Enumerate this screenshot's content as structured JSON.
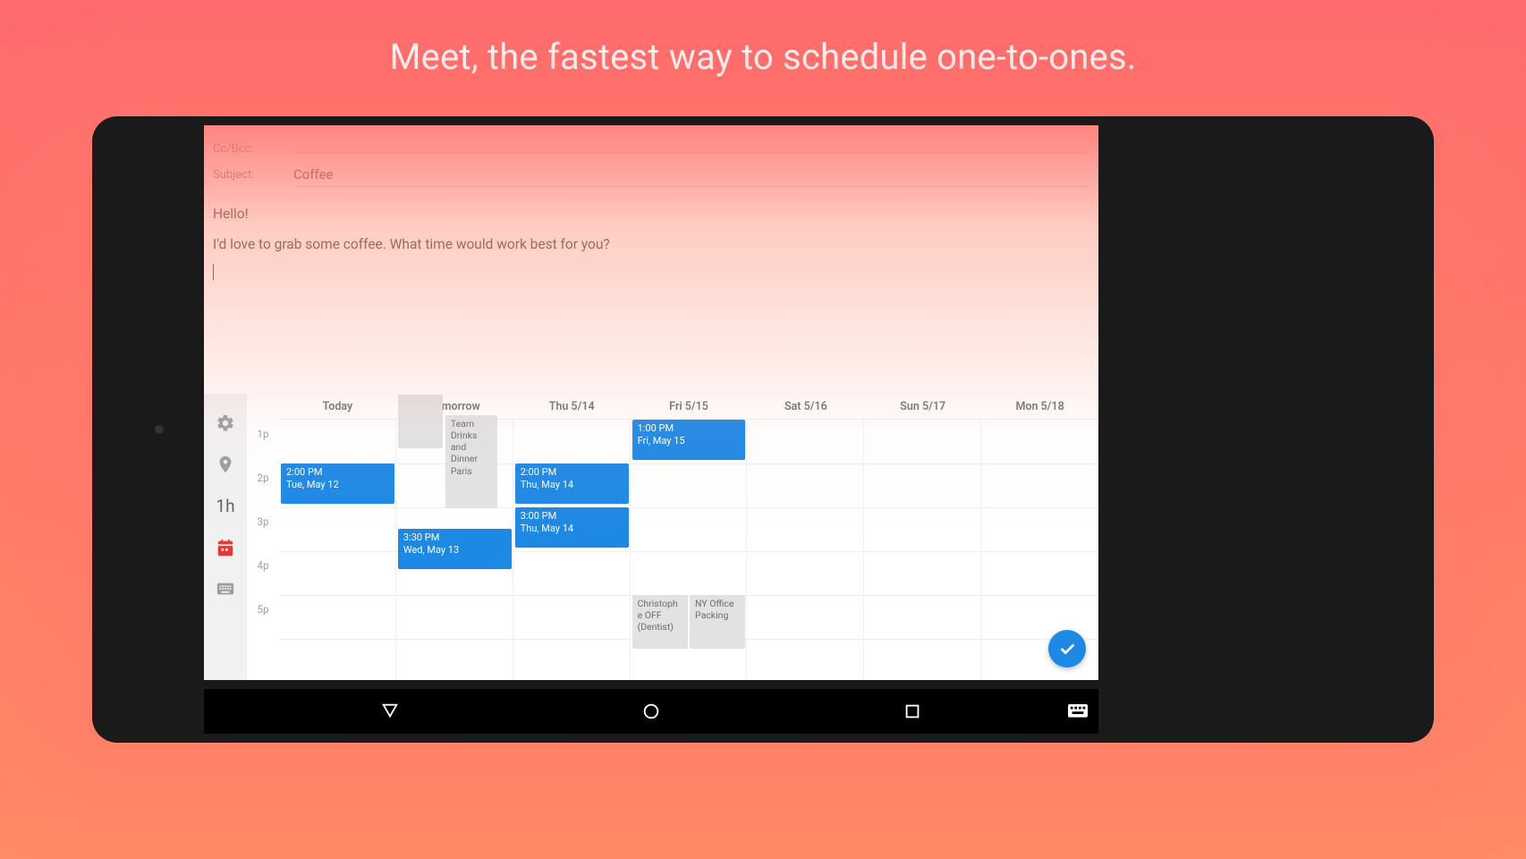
{
  "marketing": {
    "title": "Meet, the fastest way to schedule one-to-ones."
  },
  "compose": {
    "cc_label": "Cc/Bcc:",
    "cc_value": "",
    "subject_label": "Subject:",
    "subject_value": "Coffee",
    "body_line1": "Hello!",
    "body_line2": "I'd love to grab some coffee. What time would work best for you?"
  },
  "rail": {
    "duration_label": "1h"
  },
  "calendar": {
    "days": [
      "Today",
      "Tomorrow",
      "Thu 5/14",
      "Fri 5/15",
      "Sat 5/16",
      "Sun 5/17",
      "Mon 5/18"
    ],
    "hours": [
      "1p",
      "2p",
      "3p",
      "4p",
      "5p"
    ],
    "events": {
      "today_slot": {
        "time": "2:00 PM",
        "sub": "Tue, May 12"
      },
      "tomorrow_slot": {
        "time": "3:30 PM",
        "sub": "Wed, May 13"
      },
      "tomorrow_grey": {
        "title": "Team Drinks and Dinner Paris"
      },
      "thu_2": {
        "time": "2:00 PM",
        "sub": "Thu, May 14"
      },
      "thu_3": {
        "time": "3:00 PM",
        "sub": "Thu, May 14"
      },
      "fri_1": {
        "time": "1:00 PM",
        "sub": "Fri, May 15"
      },
      "fri_grey1": {
        "title": "Christophe OFF (Dentist)"
      },
      "fri_grey2": {
        "title": "NY Office Packing"
      }
    }
  }
}
